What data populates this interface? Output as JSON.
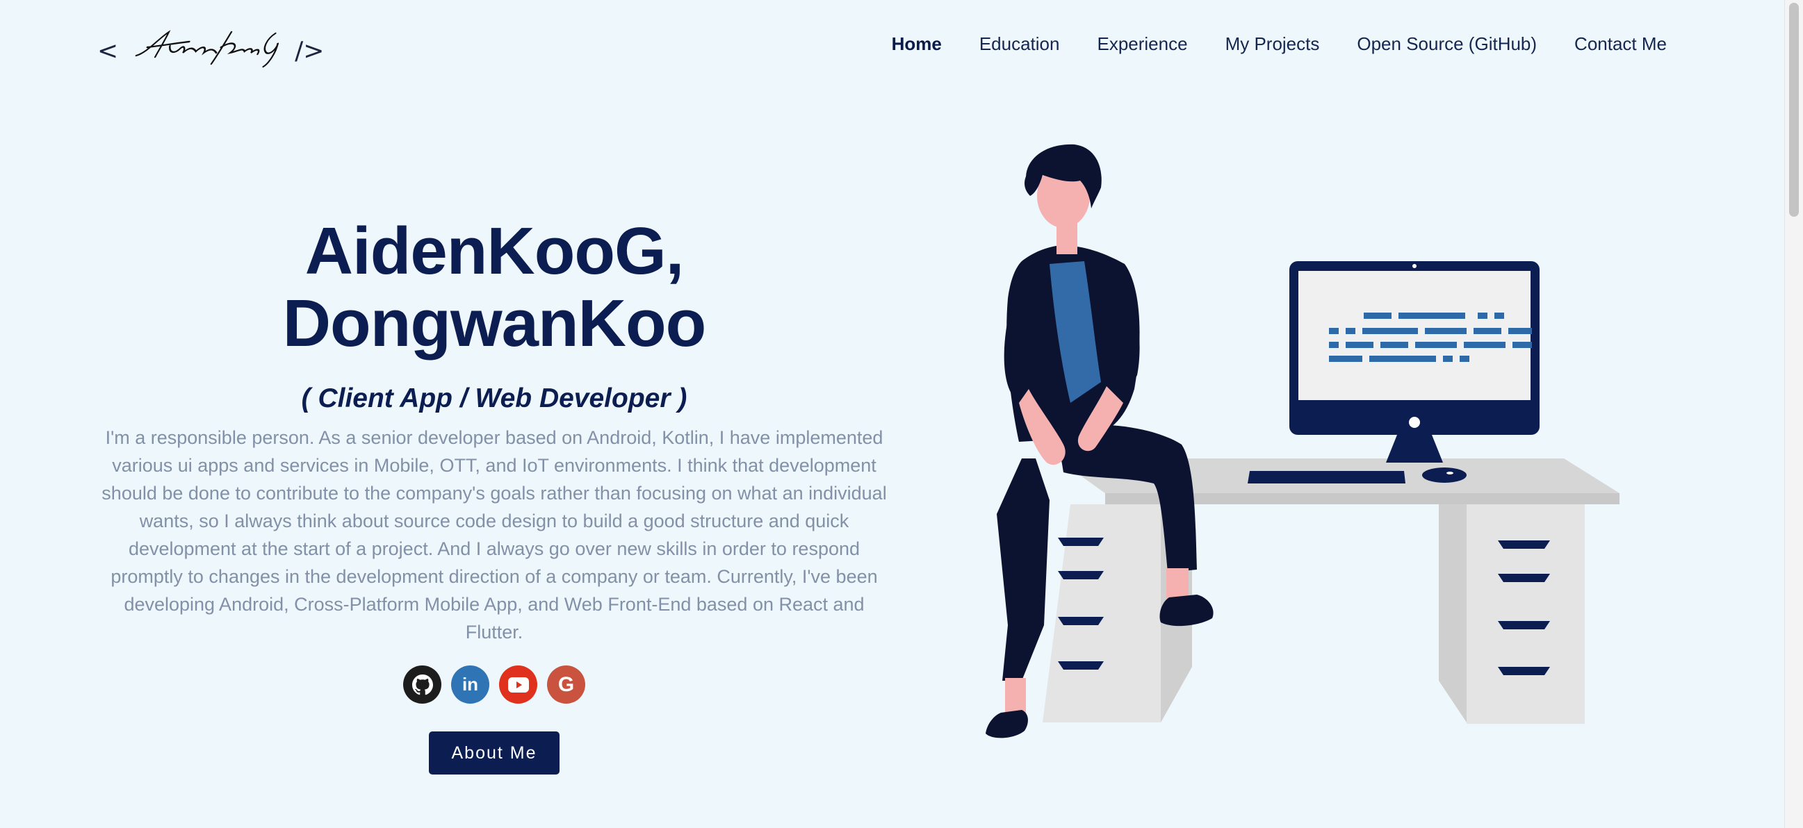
{
  "logo": {
    "open": "<",
    "signature": "AidenKooG",
    "close": "/>"
  },
  "nav": {
    "items": [
      {
        "label": "Home",
        "active": true
      },
      {
        "label": "Education"
      },
      {
        "label": "Experience"
      },
      {
        "label": "My Projects"
      },
      {
        "label": "Open Source (GitHub)"
      },
      {
        "label": "Contact Me"
      }
    ]
  },
  "hero": {
    "name_line1": "AidenKooG,",
    "name_line2": "DongwanKoo",
    "role": "( Client App / Web Developer )",
    "description": "I'm a responsible person. As a senior developer based on Android, Kotlin, I have implemented various ui apps and services in Mobile, OTT, and IoT environments. I think that development should be done to contribute to the company's goals rather than focusing on what an individual wants, so I always think about source code design to build a good structure and quick development at the start of a project. And I always go over new skills in order to respond promptly to changes in the development direction of a company or team. Currently, I've been developing Android, Cross-Platform Mobile App, and Web Front-End based on React and Flutter.",
    "socials": [
      {
        "name": "github-icon",
        "glyph": "",
        "color": "#1d1d1d"
      },
      {
        "name": "linkedin-icon",
        "glyph": "in",
        "color": "#2f74b5"
      },
      {
        "name": "youtube-icon",
        "glyph": "",
        "color": "#e0301e"
      },
      {
        "name": "google-icon",
        "glyph": "G",
        "color": "#c9533f"
      }
    ],
    "about_button": "About Me"
  },
  "colors": {
    "background": "#eef7fc",
    "primary": "#0b1d51",
    "body_text": "#8290a8"
  }
}
